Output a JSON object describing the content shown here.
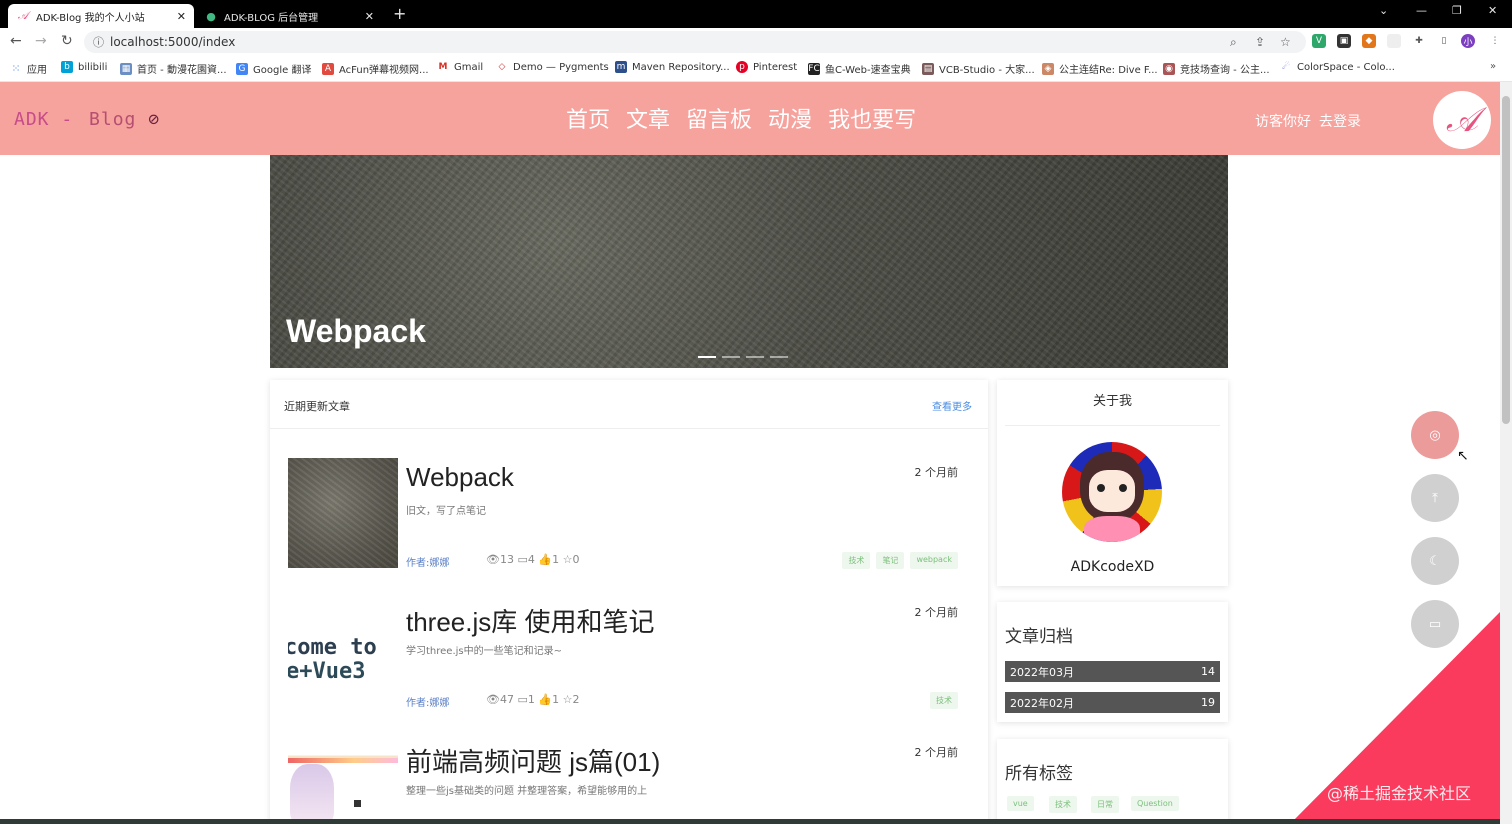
{
  "browser": {
    "tabs": [
      {
        "title": "ADK-Blog 我的个人小站",
        "active": true
      },
      {
        "title": "ADK-BLOG 后台管理",
        "active": false
      }
    ],
    "url": "localhost:5000/index",
    "bookmarks": [
      "应用",
      "bilibili",
      "首页 - 動漫花園資...",
      "Google 翻译",
      "AcFun弹幕视频网...",
      "Gmail",
      "Demo — Pygments",
      "Maven Repository...",
      "Pinterest",
      "鱼C-Web-速查宝典",
      "VCB-Studio - 大家...",
      "公主连结Re: Dive F...",
      "竞技场查询 - 公主...",
      "ColorSpace - Colo..."
    ]
  },
  "site": {
    "logo_main": "ADK",
    "logo_sep": "-",
    "logo_blog": "Blog",
    "nav": [
      "首页",
      "文章",
      "留言板",
      "动漫",
      "我也要写"
    ],
    "greeting": "访客你好",
    "login": "去登录",
    "header_color": "#f6a29d"
  },
  "hero": {
    "title": "Webpack"
  },
  "posts": {
    "heading": "近期更新文章",
    "more": "查看更多",
    "items": [
      {
        "title": "Webpack",
        "desc": "旧文，写了点笔记",
        "author": "作者:娜娜",
        "views": "13",
        "comments": "4",
        "likes": "1",
        "stars": "0",
        "time": "2 个月前",
        "tags": [
          "技术",
          "笔记",
          "webpack"
        ]
      },
      {
        "title": "three.js库 使用和笔记",
        "desc": "学习three.js中的一些笔记和记录~",
        "author": "作者:娜娜",
        "views": "47",
        "comments": "1",
        "likes": "1",
        "stars": "2",
        "time": "2 个月前",
        "tags": [
          "技术"
        ],
        "thumb_text": [
          "come to",
          "e+Vue3"
        ]
      },
      {
        "title": "前端高频问题 js篇(01)",
        "desc": "整理一些js基础类的问题 并整理答案，希望能够用的上",
        "time": "2 个月前"
      }
    ]
  },
  "about": {
    "title": "关于我",
    "name": "ADKcodeXD"
  },
  "archive": {
    "title": "文章归档",
    "rows": [
      {
        "month": "2022年03月",
        "count": "14"
      },
      {
        "month": "2022年02月",
        "count": "19"
      }
    ]
  },
  "tags": {
    "title": "所有标签",
    "items": [
      "vue",
      "技术",
      "日常",
      "Question"
    ]
  },
  "watermark": "@稀土掘金技术社区"
}
